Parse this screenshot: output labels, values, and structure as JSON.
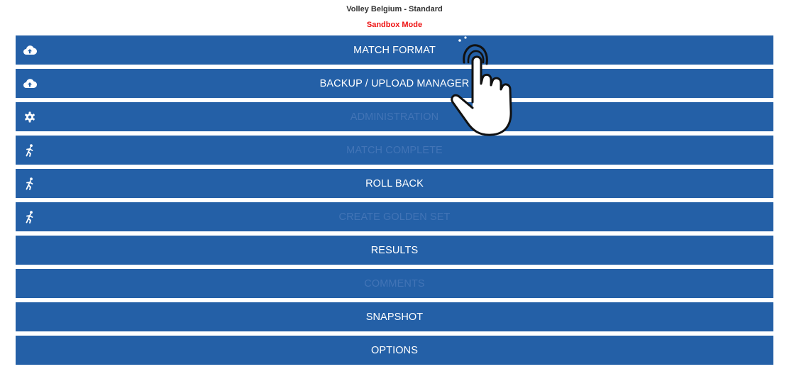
{
  "header": {
    "title": "Volley Belgium - Standard",
    "mode": "Sandbox Mode"
  },
  "menu": [
    {
      "label": "MATCH FORMAT",
      "icon": "cloud-upload-icon",
      "enabled": true
    },
    {
      "label": "BACKUP / UPLOAD MANAGER",
      "icon": "cloud-upload-icon",
      "enabled": true
    },
    {
      "label": "ADMINISTRATION",
      "icon": "gear-icon",
      "enabled": false
    },
    {
      "label": "MATCH COMPLETE",
      "icon": "running-person-icon",
      "enabled": false
    },
    {
      "label": "ROLL BACK",
      "icon": "running-person-icon",
      "enabled": true
    },
    {
      "label": "CREATE GOLDEN SET",
      "icon": "running-person-icon",
      "enabled": false
    },
    {
      "label": "RESULTS",
      "icon": "",
      "enabled": true
    },
    {
      "label": "COMMENTS",
      "icon": "",
      "enabled": false
    },
    {
      "label": "SNAPSHOT",
      "icon": "",
      "enabled": true
    },
    {
      "label": "OPTIONS",
      "icon": "",
      "enabled": true
    }
  ],
  "colors": {
    "button_bg": "#2460a7",
    "button_text": "#ffffff",
    "disabled_text": "#4274b6",
    "mode_text": "#ee1111"
  },
  "overlay": {
    "icon": "tap-hand-icon"
  }
}
